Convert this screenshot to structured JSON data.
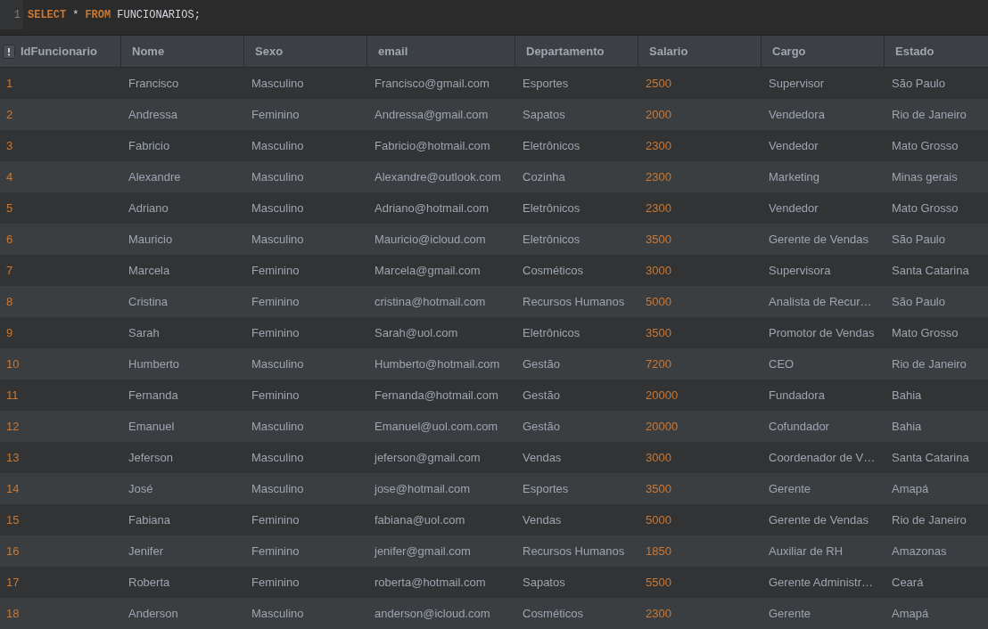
{
  "editor": {
    "lines": [
      {
        "number": "1",
        "tokens": [
          {
            "text": "SELECT",
            "kind": "keyword"
          },
          {
            "text": "*",
            "kind": "plain"
          },
          {
            "text": "FROM",
            "kind": "keyword"
          },
          {
            "text": "FUNCIONARIOS;",
            "kind": "plain"
          }
        ]
      }
    ]
  },
  "table": {
    "columns": [
      {
        "label": "IdFuncionario",
        "kind": "number"
      },
      {
        "label": "Nome",
        "kind": "text"
      },
      {
        "label": "Sexo",
        "kind": "text"
      },
      {
        "label": "email",
        "kind": "text"
      },
      {
        "label": "Departamento",
        "kind": "text"
      },
      {
        "label": "Salario",
        "kind": "number"
      },
      {
        "label": "Cargo",
        "kind": "text"
      },
      {
        "label": "Estado",
        "kind": "text"
      }
    ],
    "rows": [
      [
        "1",
        "Francisco",
        "Masculino",
        "Francisco@gmail.com",
        "Esportes",
        "2500",
        "Supervisor",
        "São Paulo"
      ],
      [
        "2",
        "Andressa",
        "Feminino",
        "Andressa@gmail.com",
        "Sapatos",
        "2000",
        "Vendedora",
        "Rio de Janeiro"
      ],
      [
        "3",
        "Fabricio",
        "Masculino",
        "Fabricio@hotmail.com",
        "Eletrônicos",
        "2300",
        "Vendedor",
        "Mato Grosso"
      ],
      [
        "4",
        "Alexandre",
        "Masculino",
        "Alexandre@outlook.com",
        "Cozinha",
        "2300",
        "Marketing",
        "Minas gerais"
      ],
      [
        "5",
        "Adriano",
        "Masculino",
        "Adriano@hotmail.com",
        "Eletrônicos",
        "2300",
        "Vendedor",
        "Mato Grosso"
      ],
      [
        "6",
        "Mauricio",
        "Masculino",
        "Mauricio@icloud.com",
        "Eletrônicos",
        "3500",
        "Gerente de Vendas",
        "São Paulo"
      ],
      [
        "7",
        "Marcela",
        "Feminino",
        "Marcela@gmail.com",
        "Cosméticos",
        "3000",
        "Supervisora",
        "Santa Catarina"
      ],
      [
        "8",
        "Cristina",
        "Feminino",
        "cristina@hotmail.com",
        "Recursos Humanos",
        "5000",
        "Analista de Recur…",
        "São Paulo"
      ],
      [
        "9",
        "Sarah",
        "Feminino",
        "Sarah@uol.com",
        "Eletrônicos",
        "3500",
        "Promotor de Vendas",
        "Mato Grosso"
      ],
      [
        "10",
        "Humberto",
        "Masculino",
        "Humberto@hotmail.com",
        "Gestão",
        "7200",
        "CEO",
        "Rio de Janeiro"
      ],
      [
        "11",
        "Fernanda",
        "Feminino",
        "Fernanda@hotmail.com",
        "Gestão",
        "20000",
        "Fundadora",
        "Bahia"
      ],
      [
        "12",
        "Emanuel",
        "Masculino",
        "Emanuel@uol.com.com",
        "Gestão",
        "20000",
        "Cofundador",
        "Bahia"
      ],
      [
        "13",
        "Jeferson",
        "Masculino",
        "jeferson@gmail.com",
        "Vendas",
        "3000",
        "Coordenador de V…",
        "Santa Catarina"
      ],
      [
        "14",
        "José",
        "Masculino",
        "jose@hotmail.com",
        "Esportes",
        "3500",
        "Gerente",
        "Amapá"
      ],
      [
        "15",
        "Fabiana",
        "Feminino",
        "fabiana@uol.com",
        "Vendas",
        "5000",
        "Gerente de Vendas",
        "Rio de Janeiro"
      ],
      [
        "16",
        "Jenifer",
        "Feminino",
        "jenifer@gmail.com",
        "Recursos Humanos",
        "1850",
        "Auxiliar de RH",
        "Amazonas"
      ],
      [
        "17",
        "Roberta",
        "Feminino",
        "roberta@hotmail.com",
        "Sapatos",
        "5500",
        "Gerente Administr…",
        "Ceará"
      ],
      [
        "18",
        "Anderson",
        "Masculino",
        "anderson@icloud.com",
        "Cosméticos",
        "2300",
        "Gerente",
        "Amapá"
      ]
    ]
  }
}
